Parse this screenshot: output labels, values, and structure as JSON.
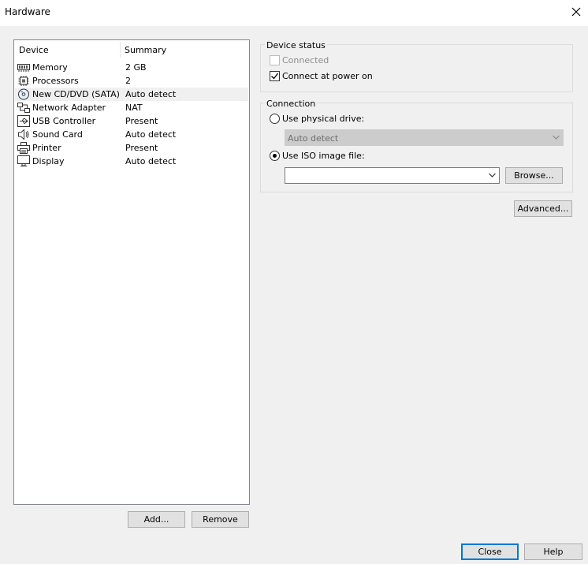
{
  "window": {
    "title": "Hardware"
  },
  "list": {
    "headers": {
      "device": "Device",
      "summary": "Summary"
    },
    "items": [
      {
        "name": "Memory",
        "summary": "2 GB",
        "icon": "memory-icon"
      },
      {
        "name": "Processors",
        "summary": "2",
        "icon": "processor-icon"
      },
      {
        "name": "New CD/DVD (SATA)",
        "summary": "Auto detect",
        "icon": "cd-dvd-icon",
        "selected": true
      },
      {
        "name": "Network Adapter",
        "summary": "NAT",
        "icon": "network-adapter-icon"
      },
      {
        "name": "USB Controller",
        "summary": "Present",
        "icon": "usb-icon"
      },
      {
        "name": "Sound Card",
        "summary": "Auto detect",
        "icon": "speaker-icon"
      },
      {
        "name": "Printer",
        "summary": "Present",
        "icon": "printer-icon"
      },
      {
        "name": "Display",
        "summary": "Auto detect",
        "icon": "monitor-icon"
      }
    ]
  },
  "buttons": {
    "add": "Add...",
    "remove": "Remove",
    "browse": "Browse...",
    "advanced": "Advanced...",
    "close": "Close",
    "help": "Help"
  },
  "device_status": {
    "label": "Device status",
    "connected": {
      "label": "Connected",
      "checked": false,
      "disabled": true
    },
    "connect_at_power_on": {
      "label": "Connect at power on",
      "checked": true
    }
  },
  "connection": {
    "label": "Connection",
    "use_physical_drive": {
      "label": "Use physical drive:",
      "selected": false
    },
    "physical_drive_value": "Auto detect",
    "use_iso": {
      "label": "Use ISO image file:",
      "selected": true
    },
    "iso_path": ""
  },
  "colors": {
    "accent": "#0078d7",
    "selected_row": "#f0f0f0",
    "window_bg": "#f0f0f0"
  }
}
